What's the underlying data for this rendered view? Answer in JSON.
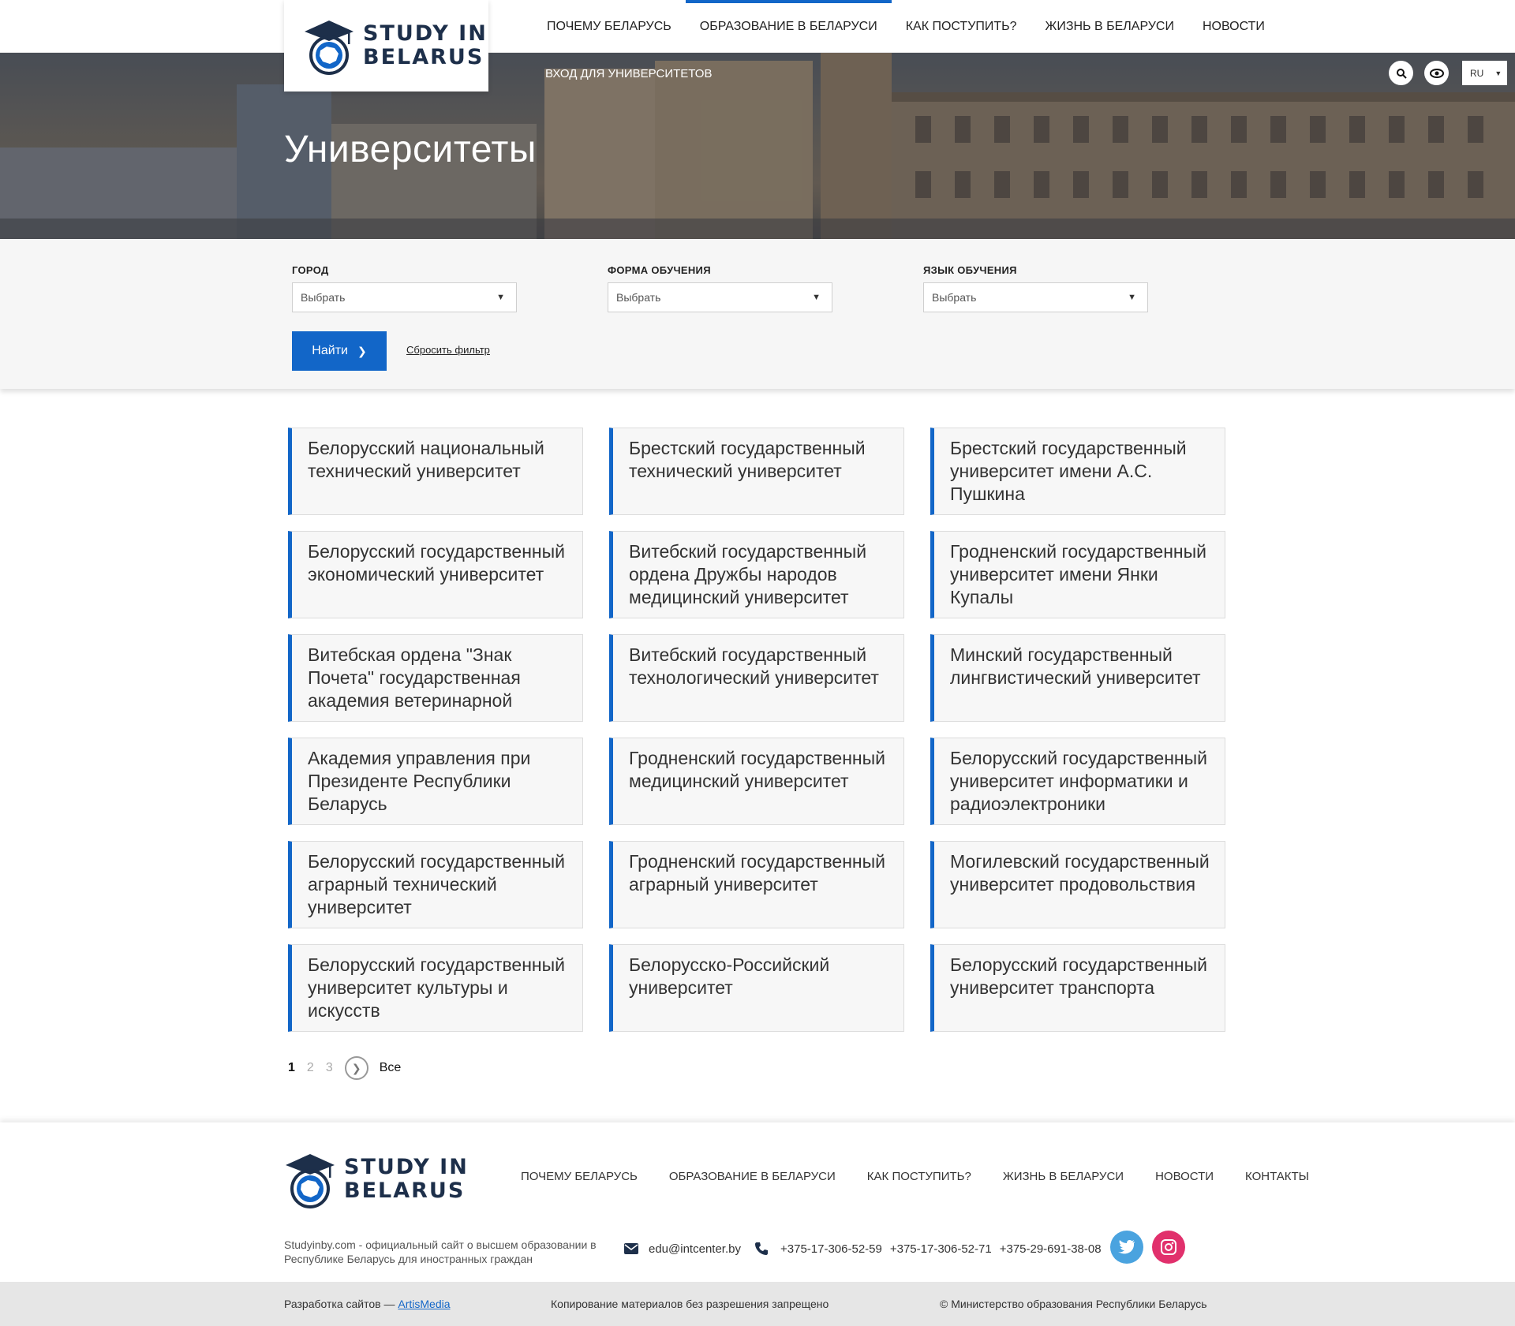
{
  "logo": {
    "line1": "STUDY IN",
    "line2": "BELARUS"
  },
  "nav": [
    {
      "label": "Почему Беларусь"
    },
    {
      "label": "Образование в Беларуси"
    },
    {
      "label": "Как поступить?"
    },
    {
      "label": "Жизнь в Беларуси"
    },
    {
      "label": "Новости"
    }
  ],
  "hero": {
    "title": "Университеты",
    "uni_login": "Вход для университетов",
    "lang": "RU"
  },
  "filter": {
    "city": {
      "label": "Город",
      "value": "Выбрать"
    },
    "form": {
      "label": "Форма обучения",
      "value": "Выбрать"
    },
    "language": {
      "label": "Язык обучения",
      "value": "Выбрать"
    },
    "find_label": "Найти",
    "reset_label": "Сбросить фильтр"
  },
  "universities": [
    "Белорусский национальный технический университет",
    "Брестский государственный технический университет",
    "Брестский государственный университет имени А.С. Пушкина",
    "Белорусский государственный экономический университет",
    "Витебский государственный ордена Дружбы народов медицинский университет",
    "Гродненский государственный университет имени Янки Купалы",
    "Витебская ордена \"Знак Почета\" государственная академия ветеринарной",
    "Витебский государственный технологический университет",
    "Минский государственный лингвистический университет",
    "Академия управления при Президенте Республики Беларусь",
    "Гродненский государственный медицинский университет",
    "Белорусский государственный университет информатики и радиоэлектроники",
    "Белорусский государственный аграрный технический университет",
    "Гродненский государственный аграрный университет",
    "Могилевский государственный университет продовольствия",
    "Белорусский государственный университет культуры и искусств",
    "Белорусско-Российский университет",
    "Белорусский государственный университет транспорта"
  ],
  "pagination": {
    "p1": "1",
    "p2": "2",
    "p3": "3",
    "all": "Все"
  },
  "footer": {
    "nav": [
      {
        "label": "Почему Беларусь"
      },
      {
        "label": "Образование в Беларуси"
      },
      {
        "label": "Как поступить?"
      },
      {
        "label": "Жизнь в Беларуси"
      },
      {
        "label": "Новости"
      },
      {
        "label": "Контакты"
      }
    ],
    "description": "Studyinby.com - официальный сайт о высшем образовании в Республике Беларусь для иностранных граждан",
    "email": "edu@intcenter.by",
    "phone1": "+375-17-306-52-59",
    "phone2": "+375-17-306-52-71",
    "phone3": "+375-29-691-38-08"
  },
  "bottom": {
    "dev_prefix": "Разработка сайтов — ",
    "dev_link": "ArtisMedia",
    "copy_notice": "Копирование материалов без разрешения запрещено",
    "copyright": "© Министерство образования Республики Беларусь"
  },
  "colors": {
    "accent": "#1266c8",
    "twitter": "#4aa3df",
    "instagram": "#e1306c"
  }
}
